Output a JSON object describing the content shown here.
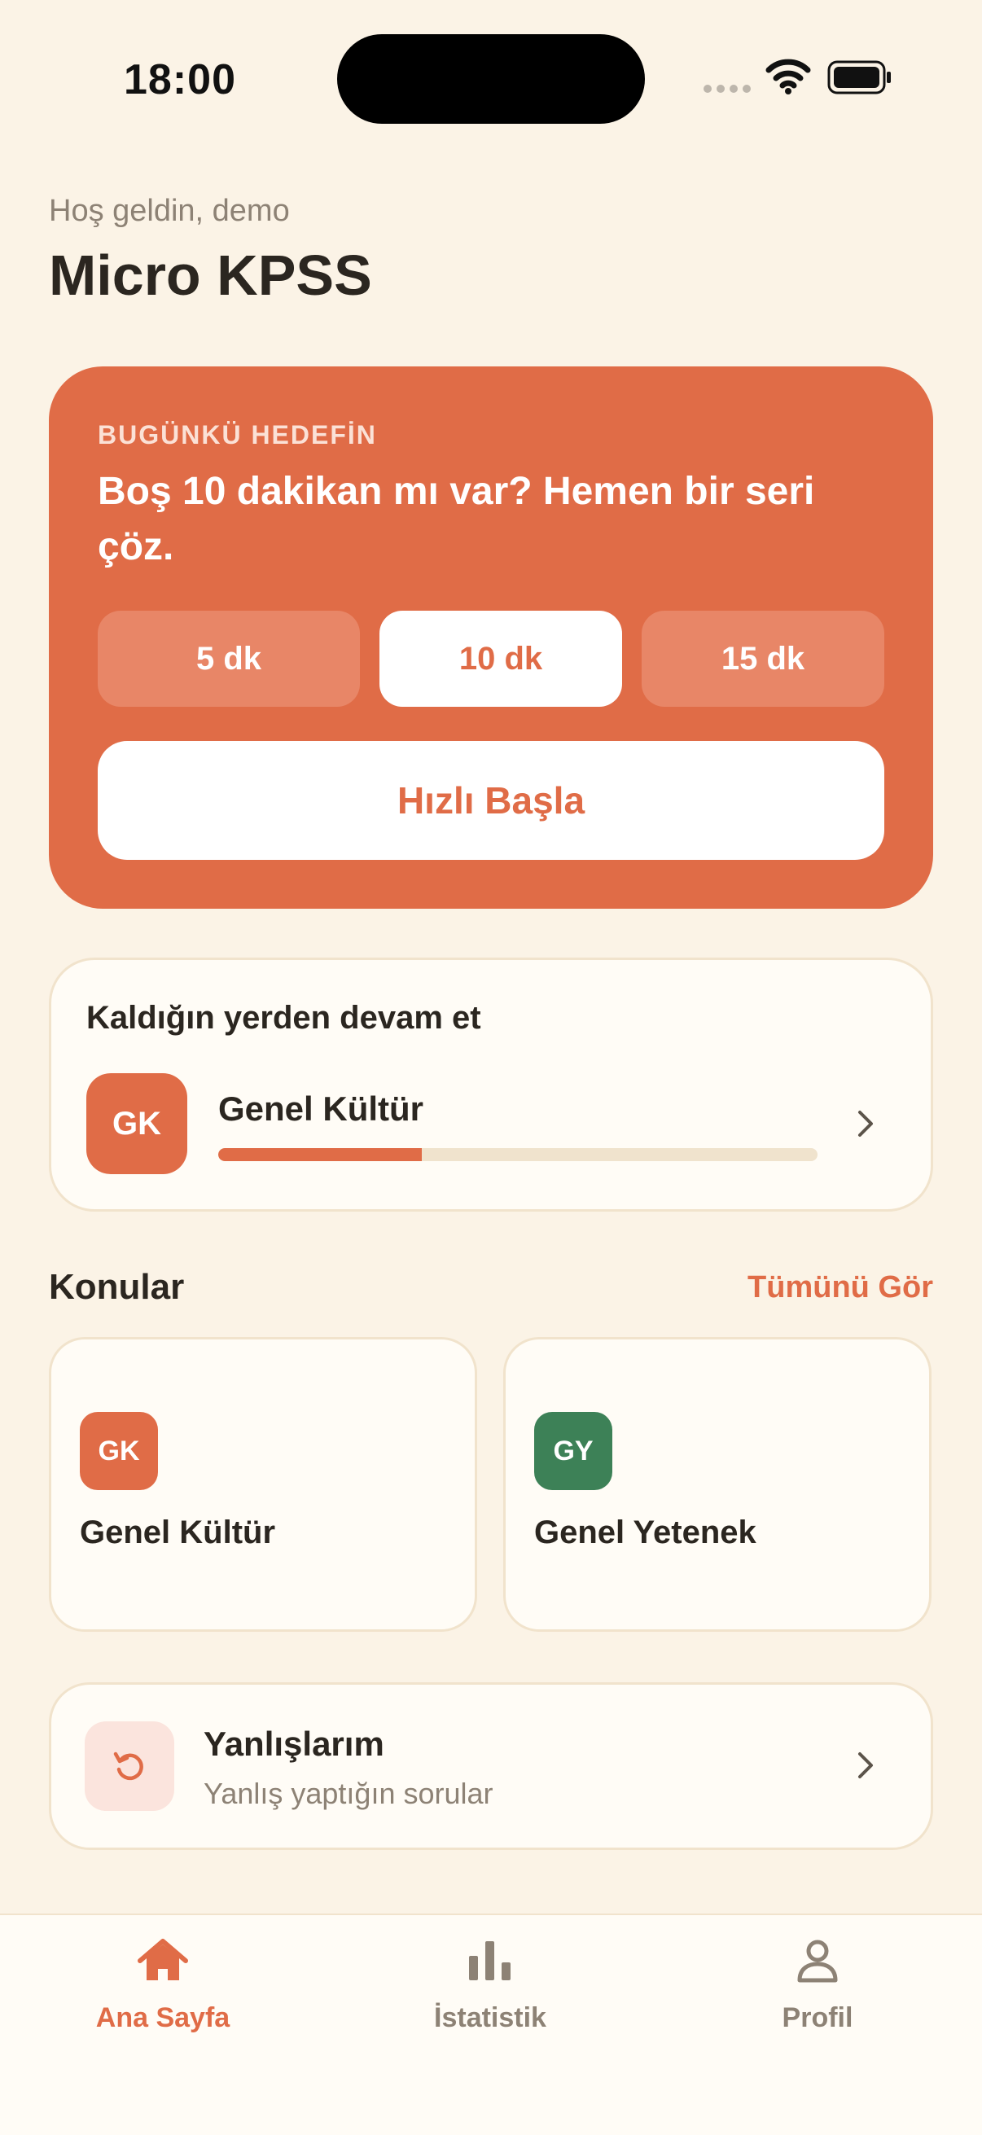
{
  "status_bar": {
    "time": "18:00"
  },
  "header": {
    "greeting": "Hoş geldin, demo",
    "title": "Micro KPSS"
  },
  "hero": {
    "label": "BUGÜNKÜ HEDEFİN",
    "text": "Boş 10 dakikan mı var? Hemen bir seri çöz.",
    "chips": [
      "5 dk",
      "10 dk",
      "15 dk"
    ],
    "selected_chip": "10 dk",
    "quick_start": "Hızlı Başla"
  },
  "continue": {
    "title": "Kaldığın yerden devam et",
    "badge": "GK",
    "subject": "Genel Kültür",
    "progress": 0.34
  },
  "topics": {
    "title": "Konular",
    "see_all": "Tümünü Gör",
    "items": [
      {
        "badge": "GK",
        "name": "Genel Kültür",
        "color": "#E06C47"
      },
      {
        "badge": "GY",
        "name": "Genel Yetenek",
        "color": "#3D8157"
      }
    ]
  },
  "wrong": {
    "title": "Yanlışlarım",
    "subtitle": "Yanlış yaptığın sorular"
  },
  "tabs": [
    {
      "label": "Ana Sayfa",
      "icon": "home-icon",
      "active": true
    },
    {
      "label": "İstatistik",
      "icon": "bar-chart-icon",
      "active": false
    },
    {
      "label": "Profil",
      "icon": "user-icon",
      "active": false
    }
  ],
  "colors": {
    "accent": "#E06C47",
    "background": "#FBF3E6",
    "green": "#3D8157"
  }
}
